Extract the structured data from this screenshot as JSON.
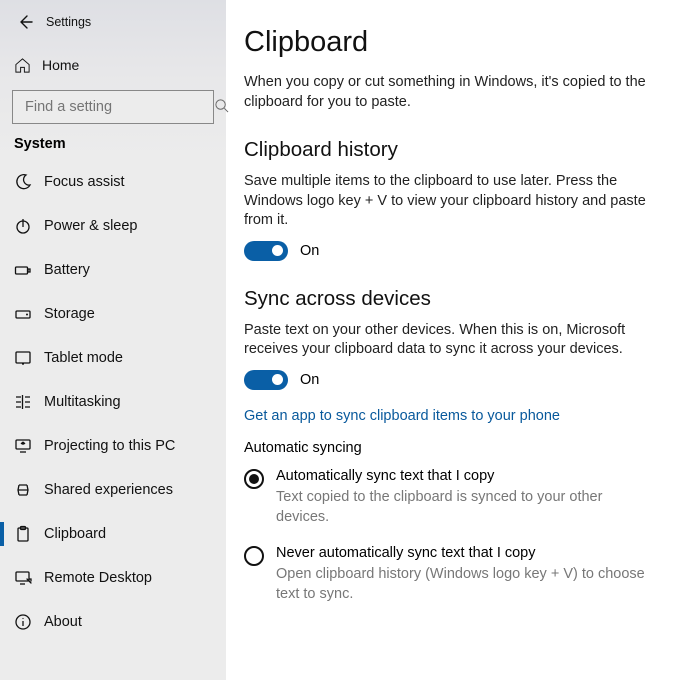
{
  "window": {
    "title": "Settings"
  },
  "sidebar": {
    "home_label": "Home",
    "search_placeholder": "Find a setting",
    "group_label": "System",
    "items": [
      {
        "label": "Focus assist"
      },
      {
        "label": "Power & sleep"
      },
      {
        "label": "Battery"
      },
      {
        "label": "Storage"
      },
      {
        "label": "Tablet mode"
      },
      {
        "label": "Multitasking"
      },
      {
        "label": "Projecting to this PC"
      },
      {
        "label": "Shared experiences"
      },
      {
        "label": "Clipboard",
        "selected": true
      },
      {
        "label": "Remote Desktop"
      },
      {
        "label": "About"
      }
    ]
  },
  "page": {
    "title": "Clipboard",
    "intro": "When you copy or cut something in Windows, it's copied to the clipboard for you to paste.",
    "history": {
      "heading": "Clipboard history",
      "desc": "Save multiple items to the clipboard to use later. Press the Windows logo key + V to view your clipboard history and paste from it.",
      "toggle_state": "On"
    },
    "sync": {
      "heading": "Sync across devices",
      "desc": "Paste text on your other devices. When this is on, Microsoft receives your clipboard data to sync it across your devices.",
      "toggle_state": "On",
      "link": "Get an app to sync clipboard items to your phone",
      "auto_heading": "Automatic syncing",
      "radios": [
        {
          "label": "Automatically sync text that I copy",
          "sub": "Text copied to the clipboard is synced to your other devices.",
          "checked": true
        },
        {
          "label": "Never automatically sync text that I copy",
          "sub": "Open clipboard history (Windows logo key + V) to choose text to sync.",
          "checked": false
        }
      ]
    }
  }
}
